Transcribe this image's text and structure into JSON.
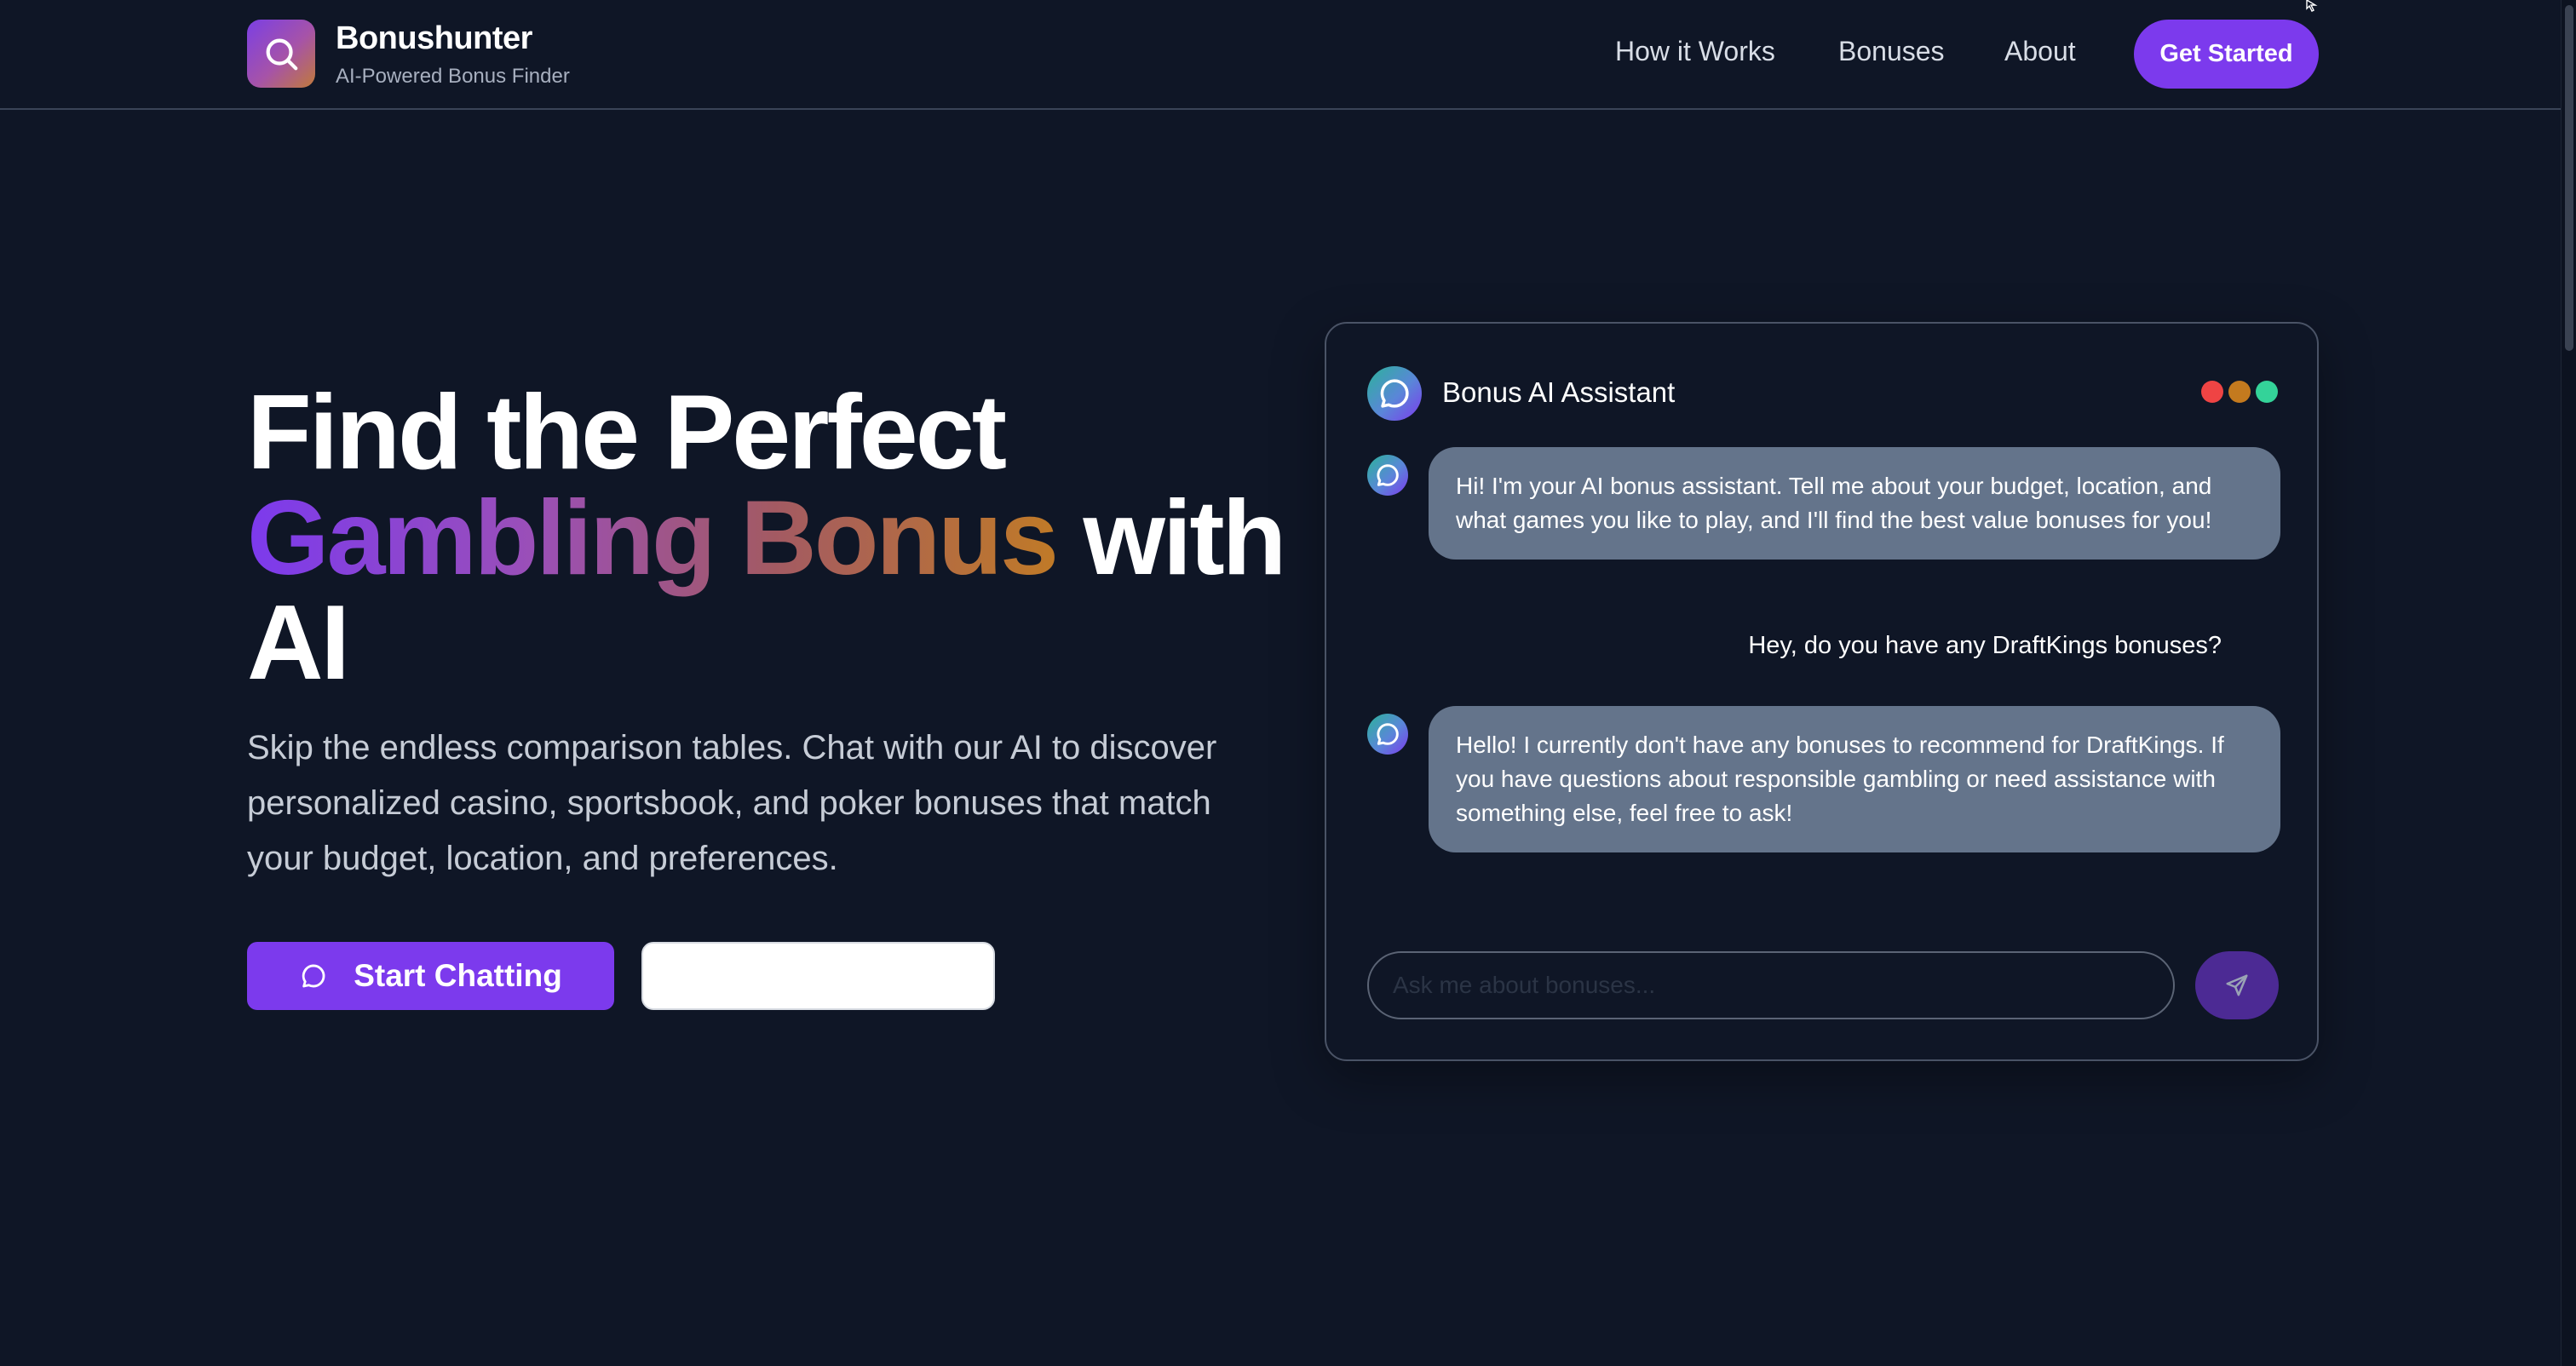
{
  "header": {
    "brand_name": "Bonushunter",
    "brand_tagline": "AI-Powered Bonus Finder",
    "logo_icon": "search-icon",
    "nav": {
      "how_it_works": "How it Works",
      "bonuses": "Bonuses",
      "about": "About"
    },
    "cta_label": "Get Started"
  },
  "hero": {
    "title_part1": "Find the Perfect",
    "title_highlight": "Gambling Bonus",
    "title_part2": "with",
    "title_part3": "AI",
    "subtitle": "Skip the endless comparison tables. Chat with our AI to discover personalized casino, sportsbook, and poker bonuses that match your budget, location, and preferences.",
    "primary_button": "Start Chatting",
    "primary_button_icon": "chat-bubble-icon",
    "secondary_button": ""
  },
  "chat": {
    "title": "Bonus AI Assistant",
    "window_dots": [
      "#ef4444",
      "#c47a1e",
      "#34d399"
    ],
    "messages": [
      {
        "role": "assistant",
        "text": "Hi! I'm your AI bonus assistant. Tell me about your budget, location, and what games you like to play, and I'll find the best value bonuses for you!"
      },
      {
        "role": "user",
        "text": "Hey, do you have any DraftKings bonuses?"
      },
      {
        "role": "assistant",
        "text": "Hello! I currently don't have any bonuses to recommend for DraftKings. If you have questions about responsible gambling or need assistance with something else, feel free to ask!"
      }
    ],
    "input_placeholder": "Ask me about bonuses...",
    "send_icon": "send-icon"
  },
  "colors": {
    "background": "#0f1626",
    "accent": "#7c3aed",
    "bubble": "#64748b",
    "gradient_start": "#7c3aed",
    "gradient_end": "#c07a27"
  }
}
